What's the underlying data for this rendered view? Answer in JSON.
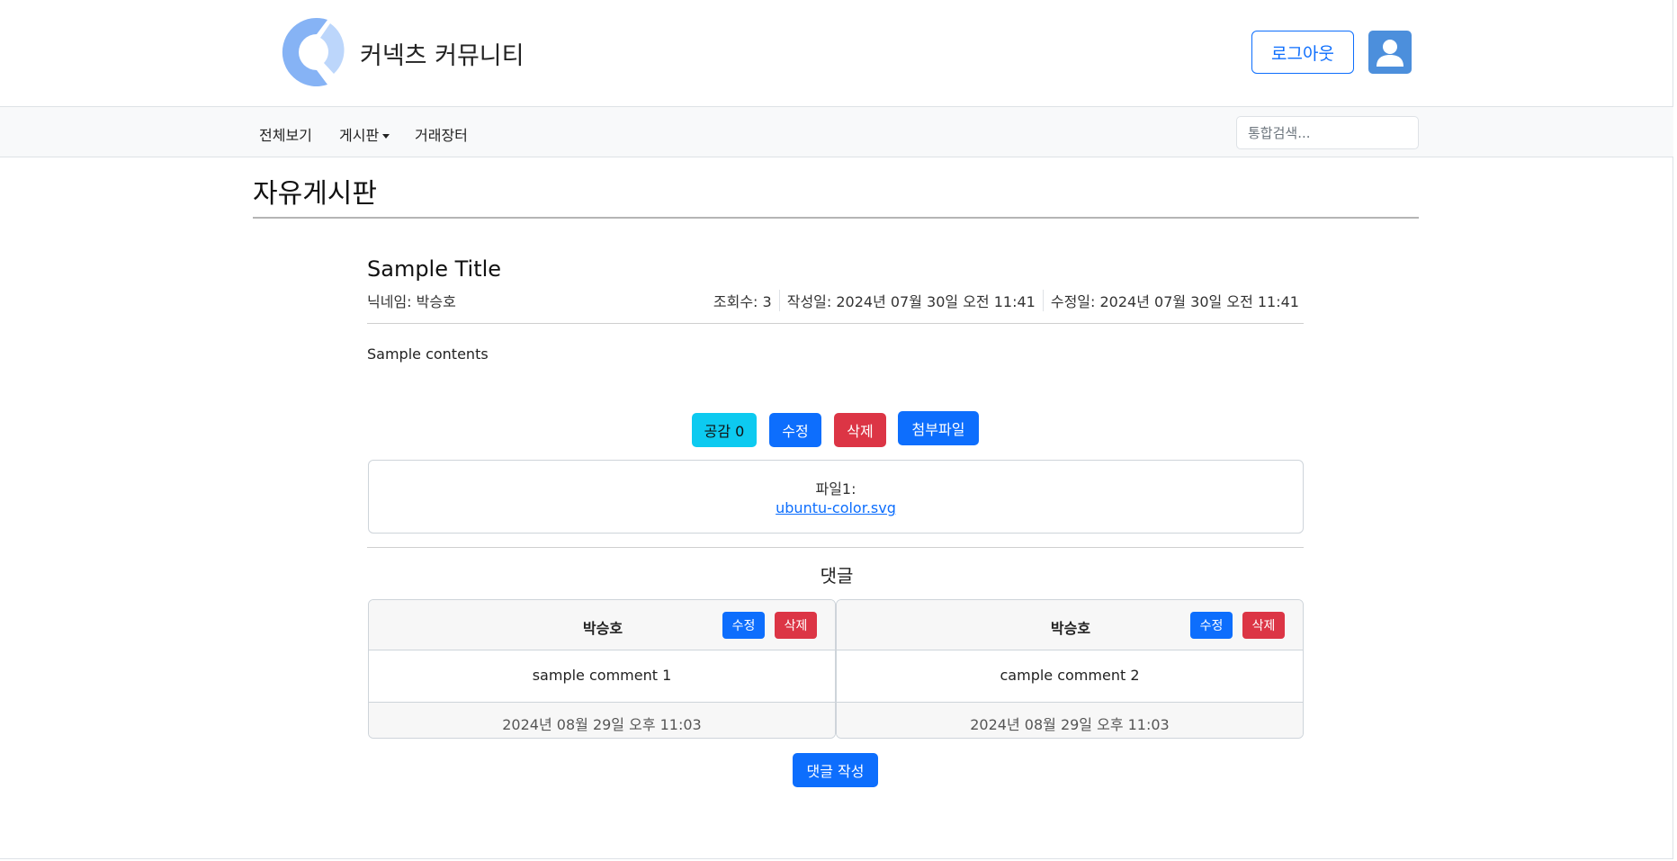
{
  "header": {
    "brand": "커넥츠 커뮤니티",
    "logout_label": "로그아웃",
    "logo_icon": "logo-icon",
    "avatar_icon": "user-icon",
    "brand_color": "#86b3f5"
  },
  "nav": {
    "items": [
      {
        "label": "전체보기"
      },
      {
        "label": "게시판"
      },
      {
        "label": "거래장터"
      }
    ],
    "search_placeholder": "통합검색..."
  },
  "board": {
    "title": "자유게시판"
  },
  "post": {
    "title": "Sample Title",
    "nickname": "닉네임: 박승호",
    "views": "조회수: 3",
    "created": "작성일: 2024년 07월 30일 오전 11:41",
    "modified": "수정일: 2024년 07월 30일 오전 11:41",
    "content": "Sample contents",
    "like_label": "공감 0",
    "edit_label": "수정",
    "delete_label": "삭제",
    "attach_label": "첨부파일",
    "file_label": "파일1:",
    "file_name": "ubuntu-color.svg"
  },
  "comments": {
    "title": "댓글",
    "items": [
      {
        "author": "박승호",
        "edit": "수정",
        "delete": "삭제",
        "text": "sample comment 1",
        "date": "2024년 08월 29일 오후 11:03"
      },
      {
        "author": "박승호",
        "edit": "수정",
        "delete": "삭제",
        "text": "cample comment 2",
        "date": "2024년 08월 29일 오후 11:03"
      }
    ],
    "write_label": "댓글 작성"
  },
  "colors": {
    "primary": "#0d6efd",
    "danger": "#dc3545",
    "info": "#0dcaf0"
  }
}
